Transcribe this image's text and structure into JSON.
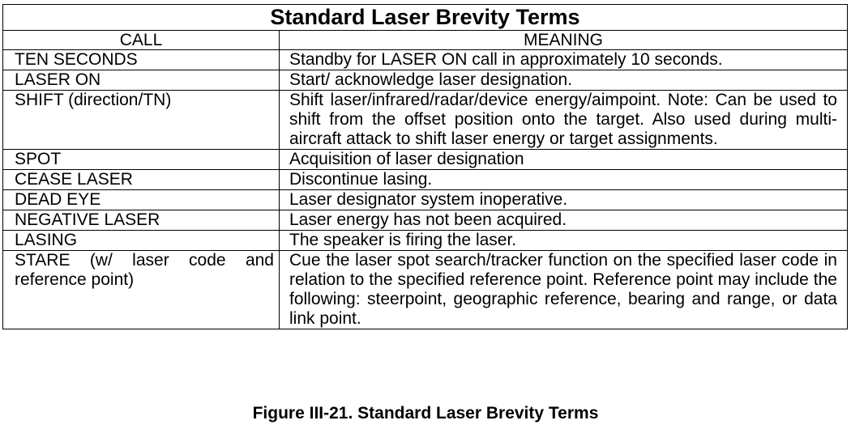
{
  "table": {
    "title": "Standard Laser Brevity Terms",
    "headers": {
      "call": "CALL",
      "meaning": "MEANING"
    },
    "rows": [
      {
        "call": "TEN SECONDS",
        "meaning": "Standby for LASER ON call in approximately 10 seconds."
      },
      {
        "call": "LASER ON",
        "meaning": "Start/ acknowledge laser designation."
      },
      {
        "call": "SHIFT (direction/TN)",
        "meaning": "Shift laser/infrared/radar/device energy/aimpoint. Note: Can be used to shift from the offset position onto the target. Also used during multi-aircraft attack to shift laser energy or target assignments."
      },
      {
        "call": "SPOT",
        "meaning": "Acquisition of laser designation"
      },
      {
        "call": "CEASE LASER",
        "meaning": "Discontinue lasing."
      },
      {
        "call": "DEAD EYE",
        "meaning": "Laser designator system inoperative."
      },
      {
        "call": "NEGATIVE LASER",
        "meaning": "Laser energy has not been acquired."
      },
      {
        "call": "LASING",
        "meaning": "The speaker is firing the laser."
      },
      {
        "call": "STARE (w/ laser code and reference point)",
        "meaning": "Cue the laser spot search/tracker function on the specified laser code in relation to the specified reference point. Reference point may include the following: steerpoint, geographic reference, bearing and range, or data link point."
      }
    ]
  },
  "caption": "Figure III-21.  Standard Laser Brevity Terms"
}
